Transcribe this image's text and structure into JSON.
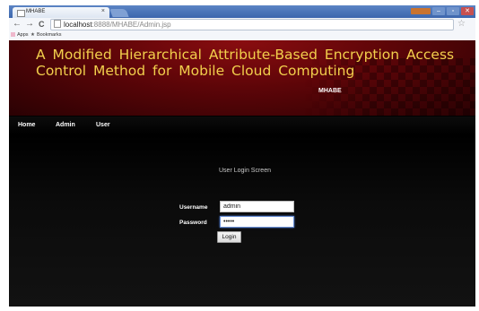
{
  "browser": {
    "tab_title": "MHABE",
    "tab_close": "×",
    "user_badge": "",
    "min": "–",
    "max": "▫",
    "close": "✕",
    "back": "←",
    "forward": "→",
    "reload": "C",
    "url_host": "localhost",
    "url_path": ":8888/MHABE/Admin.jsp",
    "star": "☆",
    "bookmarks": {
      "apps": "Apps",
      "bookmarks": "Bookmarks"
    }
  },
  "site": {
    "title": "A Modified Hierarchical Attribute-Based Encryption Access Control Method for Mobile Cloud Computing",
    "subtitle": "MHABE"
  },
  "nav": {
    "items": [
      "Home",
      "Admin",
      "User"
    ]
  },
  "login": {
    "heading": "User Login Screen",
    "username_label": "Username",
    "username_value": "admin",
    "password_label": "Password",
    "password_value": "•••••",
    "submit_label": "Login"
  },
  "colors": {
    "banner": "#5d0508",
    "title": "#f2cf4c",
    "chrome": "#3c66ad"
  },
  "icons": [
    "page-icon",
    "star-icon",
    "apps-icon",
    "bookmark-star-icon"
  ]
}
